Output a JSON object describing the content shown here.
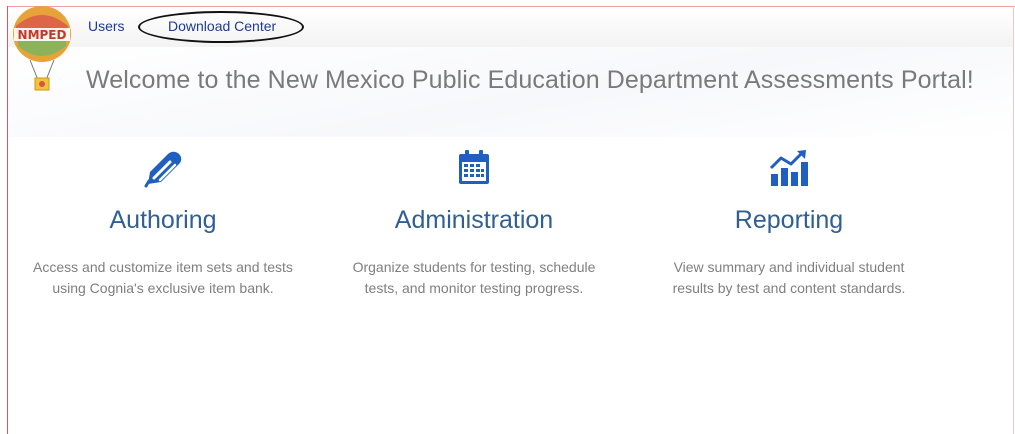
{
  "nav": {
    "users": "Users",
    "download_center": "Download Center"
  },
  "logo": {
    "text": "NMPED"
  },
  "welcome": "Welcome to the New Mexico Public Education Department Assessments Portal!",
  "cards": [
    {
      "icon": "pencil-icon",
      "title": "Authoring",
      "description": "Access and customize item sets and tests using Cognia's exclusive item bank."
    },
    {
      "icon": "calendar-icon",
      "title": "Administration",
      "description": "Organize students for testing, schedule tests, and monitor testing progress."
    },
    {
      "icon": "chart-growth-icon",
      "title": "Reporting",
      "description": "View summary and individual student results by test and content standards."
    }
  ],
  "colors": {
    "nav_link": "#1f3a93",
    "card_title": "#2f5f93",
    "icon_blue": "#1f5fbf",
    "body_text": "#7f7f7f"
  }
}
